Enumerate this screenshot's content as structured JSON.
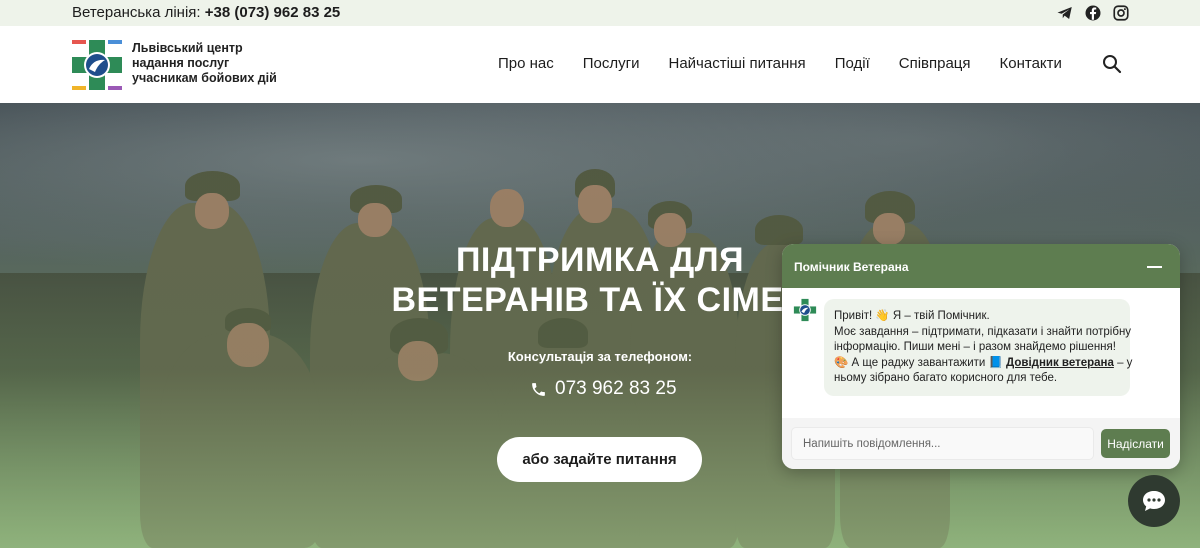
{
  "topbar": {
    "hotline_label": "Ветеранська лінія:",
    "hotline_number": "+38 (073) 962 83 25",
    "socials": [
      "telegram-icon",
      "facebook-icon",
      "instagram-icon"
    ]
  },
  "header": {
    "org_name": [
      "Львівський центр",
      "надання послуг",
      "учасникам бойових дій"
    ],
    "nav": [
      "Про нас",
      "Послуги",
      "Найчастіші питання",
      "Події",
      "Співпраця",
      "Контакти"
    ]
  },
  "hero": {
    "title_line1": "ПІДТРИМКА ДЛЯ",
    "title_line2": "ВЕТЕРАНІВ ТА ЇХ СІМЕЙ",
    "consult_label": "Консультація за телефоном:",
    "phone": "073 962 83 25",
    "ask_button": "або задайте питання"
  },
  "chat": {
    "title": "Помічник Ветерана",
    "message": {
      "line1": "Привіт! 👋 Я – твій Помічник.",
      "line2": "Моє завдання – підтримати, підказати і знайти потрібну",
      "line3": "інформацію. Пиши мені – і разом знайдемо рішення!",
      "line4_pre": "🎨 А ще раджу завантажити 📘",
      "line4_link": "Довідник ветерана",
      "line4_post": "– у",
      "line5": "ньому зібрано багато корисного для тебе."
    },
    "input_placeholder": "Напишіть повідомлення...",
    "send_label": "Надіслати"
  },
  "colors": {
    "accent_green": "#5e7d50",
    "topbar_bg": "#eef3ea",
    "fab_dark": "#2f3a30"
  }
}
